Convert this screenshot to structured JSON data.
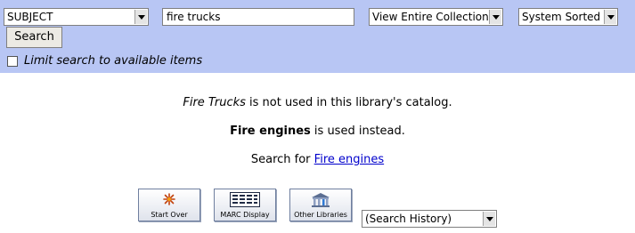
{
  "search": {
    "index_value": "SUBJECT",
    "query_value": "fire trucks",
    "scope_value": "View Entire Collection",
    "sort_value": "System Sorted",
    "search_button_label": "Search",
    "limit_label": "Limit search to available items",
    "limit_checked": false
  },
  "message": {
    "unused_term": "Fire Trucks",
    "unused_suffix": " is not used in this library's catalog.",
    "preferred_term": "Fire engines",
    "preferred_suffix": " is used instead.",
    "search_for_prefix": "Search for ",
    "search_for_link": "Fire engines"
  },
  "toolbar": {
    "start_over_label": "Start Over",
    "marc_display_label": "MARC Display",
    "other_libraries_label": "Other Libraries",
    "history_value": "(Search History)"
  },
  "icons": {
    "start_over": "starburst-icon",
    "marc_display": "marc-grid-icon",
    "other_libraries": "library-building-icon"
  },
  "colors": {
    "search_band": "#b8c6f4",
    "link": "#0000cc"
  }
}
